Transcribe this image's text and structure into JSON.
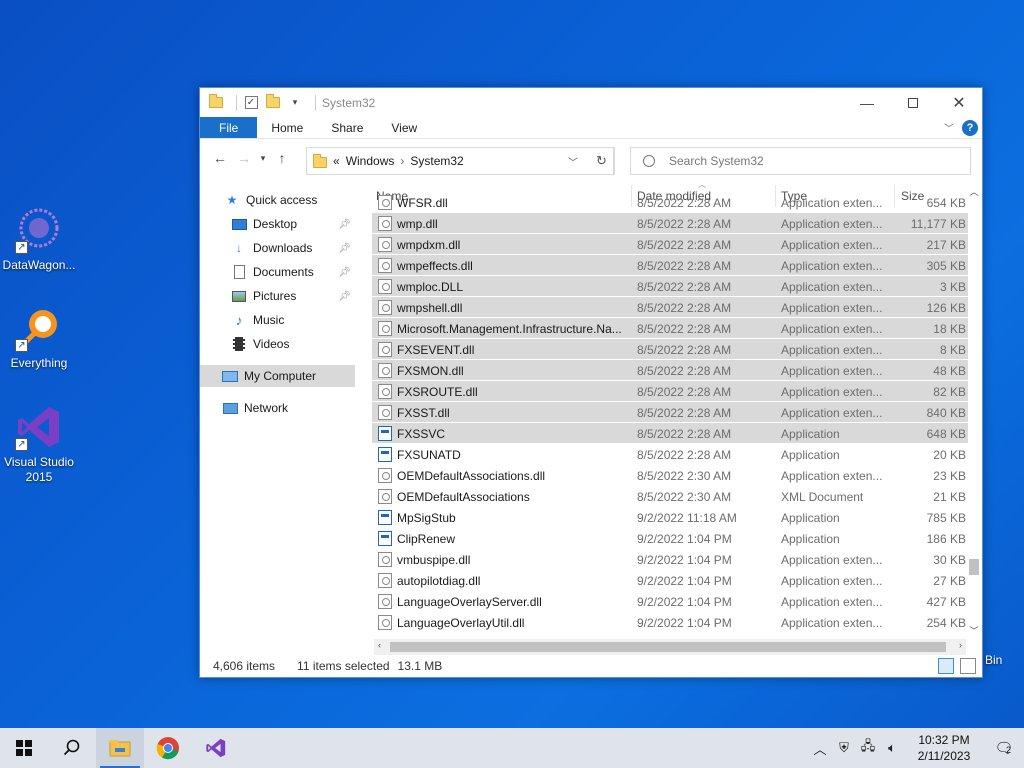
{
  "desktop": {
    "icons": [
      {
        "label": "DataWagon..."
      },
      {
        "label": "Everything"
      },
      {
        "label": "Visual Studio 2015"
      }
    ],
    "recycle_label": "e Bin"
  },
  "window": {
    "title": "System32",
    "tabs": [
      "File",
      "Home",
      "Share",
      "View"
    ],
    "address": {
      "overflow": "«",
      "crumbs": [
        "Windows",
        "System32"
      ]
    },
    "search_placeholder": "Search System32",
    "nav": {
      "quick_access": "Quick access",
      "items": [
        "Desktop",
        "Downloads",
        "Documents",
        "Pictures",
        "Music",
        "Videos"
      ],
      "my_computer": "My Computer",
      "network": "Network"
    },
    "columns": {
      "name": "Name",
      "date": "Date modified",
      "type": "Type",
      "size": "Size"
    },
    "rows": [
      {
        "name": "WFSR.dll",
        "date": "8/5/2022 2:28 AM",
        "type": "Application exten...",
        "size": "654 KB",
        "selected": false,
        "kind": "dll"
      },
      {
        "name": "wmp.dll",
        "date": "8/5/2022 2:28 AM",
        "type": "Application exten...",
        "size": "11,177 KB",
        "selected": true,
        "kind": "dll"
      },
      {
        "name": "wmpdxm.dll",
        "date": "8/5/2022 2:28 AM",
        "type": "Application exten...",
        "size": "217 KB",
        "selected": true,
        "kind": "dll"
      },
      {
        "name": "wmpeffects.dll",
        "date": "8/5/2022 2:28 AM",
        "type": "Application exten...",
        "size": "305 KB",
        "selected": true,
        "kind": "dll"
      },
      {
        "name": "wmploc.DLL",
        "date": "8/5/2022 2:28 AM",
        "type": "Application exten...",
        "size": "3 KB",
        "selected": true,
        "kind": "dll"
      },
      {
        "name": "wmpshell.dll",
        "date": "8/5/2022 2:28 AM",
        "type": "Application exten...",
        "size": "126 KB",
        "selected": true,
        "kind": "dll"
      },
      {
        "name": "Microsoft.Management.Infrastructure.Na...",
        "date": "8/5/2022 2:28 AM",
        "type": "Application exten...",
        "size": "18 KB",
        "selected": true,
        "kind": "dll"
      },
      {
        "name": "FXSEVENT.dll",
        "date": "8/5/2022 2:28 AM",
        "type": "Application exten...",
        "size": "8 KB",
        "selected": true,
        "kind": "dll"
      },
      {
        "name": "FXSMON.dll",
        "date": "8/5/2022 2:28 AM",
        "type": "Application exten...",
        "size": "48 KB",
        "selected": true,
        "kind": "dll"
      },
      {
        "name": "FXSROUTE.dll",
        "date": "8/5/2022 2:28 AM",
        "type": "Application exten...",
        "size": "82 KB",
        "selected": true,
        "kind": "dll"
      },
      {
        "name": "FXSST.dll",
        "date": "8/5/2022 2:28 AM",
        "type": "Application exten...",
        "size": "840 KB",
        "selected": true,
        "kind": "dll"
      },
      {
        "name": "FXSSVC",
        "date": "8/5/2022 2:28 AM",
        "type": "Application",
        "size": "648 KB",
        "selected": true,
        "kind": "app"
      },
      {
        "name": "FXSUNATD",
        "date": "8/5/2022 2:28 AM",
        "type": "Application",
        "size": "20 KB",
        "selected": false,
        "kind": "app"
      },
      {
        "name": "OEMDefaultAssociations.dll",
        "date": "8/5/2022 2:30 AM",
        "type": "Application exten...",
        "size": "23 KB",
        "selected": false,
        "kind": "dll"
      },
      {
        "name": "OEMDefaultAssociations",
        "date": "8/5/2022 2:30 AM",
        "type": "XML Document",
        "size": "21 KB",
        "selected": false,
        "kind": "dll"
      },
      {
        "name": "MpSigStub",
        "date": "9/2/2022 11:18 AM",
        "type": "Application",
        "size": "785 KB",
        "selected": false,
        "kind": "app"
      },
      {
        "name": "ClipRenew",
        "date": "9/2/2022 1:04 PM",
        "type": "Application",
        "size": "186 KB",
        "selected": false,
        "kind": "app"
      },
      {
        "name": "vmbuspipe.dll",
        "date": "9/2/2022 1:04 PM",
        "type": "Application exten...",
        "size": "30 KB",
        "selected": false,
        "kind": "dll"
      },
      {
        "name": "autopilotdiag.dll",
        "date": "9/2/2022 1:04 PM",
        "type": "Application exten...",
        "size": "27 KB",
        "selected": false,
        "kind": "dll"
      },
      {
        "name": "LanguageOverlayServer.dll",
        "date": "9/2/2022 1:04 PM",
        "type": "Application exten...",
        "size": "427 KB",
        "selected": false,
        "kind": "dll"
      },
      {
        "name": "LanguageOverlayUtil.dll",
        "date": "9/2/2022 1:04 PM",
        "type": "Application exten...",
        "size": "254 KB",
        "selected": false,
        "kind": "dll"
      }
    ],
    "status": {
      "count": "4,606 items",
      "selected": "11 items selected",
      "size": "13.1 MB"
    }
  },
  "taskbar": {
    "time": "10:32 PM",
    "date": "2/11/2023",
    "notifications": "2"
  }
}
